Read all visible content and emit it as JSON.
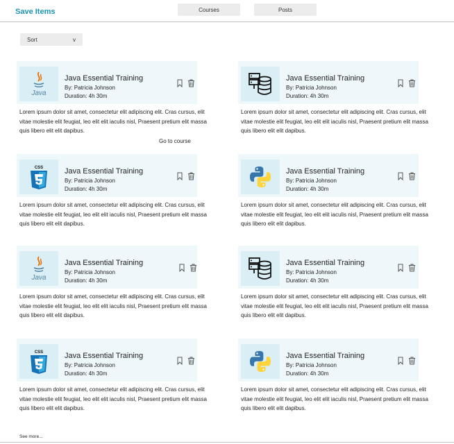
{
  "header": {
    "brand": "Save Items",
    "tabs": [
      "Courses",
      "Posts"
    ]
  },
  "sort": {
    "label": "Sort",
    "chevron": "v"
  },
  "cards": [
    {
      "icon": "java-logo-icon",
      "title": "Java Essential Training",
      "author": "By: Patricia Johnson",
      "duration": "Duration: 4h 30m",
      "description": "Lorem ipsum dolor sit amet, consectetur  elit  adipiscing elit. Cras cursus, elit vitae molestie elit feugiat, leo elit elit iaculis nisl, Praesent pretium elit massa quis libero elit elit dapibus.",
      "link": "Go to course"
    },
    {
      "icon": "database-server-icon",
      "title": "Java Essential Training",
      "author": "By: Patricia Johnson",
      "duration": "Duration: 4h 30m",
      "description": "Lorem ipsum dolor sit amet, consectetur  elit  adipiscing elit. Cras cursus, elit vitae molestie elit feugiat, leo elit elit iaculis nisl, Praesent pretium elit massa quis libero elit elit dapibus."
    },
    {
      "icon": "css3-logo-icon",
      "title": "Java Essential Training",
      "author": "By: Patricia Johnson",
      "duration": "Duration: 4h 30m",
      "description": "Lorem ipsum dolor sit amet, consectetur  elit  adipiscing elit. Cras cursus, elit vitae molestie elit feugiat, leo elit elit iaculis nisl, Praesent pretium elit massa quis libero elit elit dapibus."
    },
    {
      "icon": "python-logo-icon",
      "title": "Java Essential Training",
      "author": "By: Patricia Johnson",
      "duration": "Duration: 4h 30m",
      "description": "Lorem ipsum dolor sit amet, consectetur  elit  adipiscing elit. Cras cursus, elit vitae molestie elit feugiat, leo elit elit iaculis nisl, Praesent pretium elit massa quis libero elit elit dapibus."
    },
    {
      "icon": "java-logo-icon",
      "title": "Java Essential Training",
      "author": "By: Patricia Johnson",
      "duration": "Duration: 4h 30m",
      "description": "Lorem ipsum dolor sit amet, consectetur  elit  adipiscing elit. Cras cursus, elit vitae molestie elit feugiat, leo elit elit iaculis nisl, Praesent pretium elit massa quis libero elit elit dapibus."
    },
    {
      "icon": "database-server-icon",
      "title": "Java Essential Training",
      "author": "By: Patricia Johnson",
      "duration": "Duration: 4h 30m",
      "description": "Lorem ipsum dolor sit amet, consectetur  elit  adipiscing elit. Cras cursus, elit vitae molestie elit feugiat, leo elit elit iaculis nisl, Praesent pretium elit massa quis libero elit elit dapibus."
    },
    {
      "icon": "css3-logo-icon",
      "title": "Java Essential Training",
      "author": "By: Patricia Johnson",
      "duration": "Duration: 4h 30m",
      "description": "Lorem ipsum dolor sit amet, consectetur  elit  adipiscing elit. Cras cursus, elit vitae molestie elit feugiat, leo elit elit iaculis nisl, Praesent pretium elit massa quis libero elit elit dapibus."
    },
    {
      "icon": "python-logo-icon",
      "title": "Java Essential Training",
      "author": "By: Patricia Johnson",
      "duration": "Duration: 4h 30m",
      "description": "Lorem ipsum dolor sit amet, consectetur  elit  adipiscing elit. Cras cursus, elit vitae molestie elit feugiat, leo elit elit iaculis nisl, Praesent pretium elit massa quis libero elit elit dapibus."
    }
  ],
  "see_more": "See more...",
  "colors": {
    "brand": "#1c93b4",
    "card_header_bg": "#eef7fa",
    "thumb_bg": "#d9eef5",
    "tab_bg": "#ececec"
  }
}
